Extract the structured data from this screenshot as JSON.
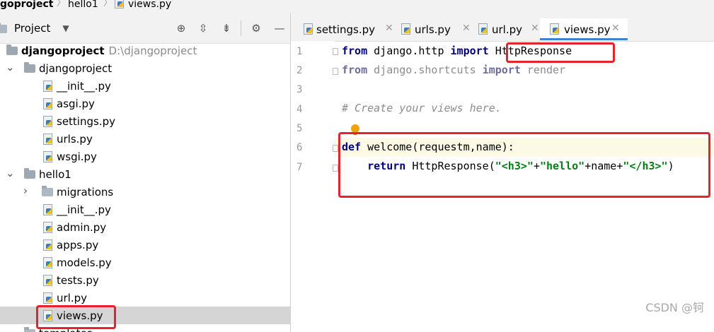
{
  "breadcrumb": {
    "items": [
      "goproject",
      "hello1",
      "views.py"
    ]
  },
  "project_panel": {
    "title": "Project",
    "tool_icons": [
      "locate-icon",
      "expand-all-icon",
      "collapse-all-icon",
      "gear-icon",
      "hide-icon"
    ],
    "tree": [
      {
        "label": "djangoproject",
        "path": "D:\\djangoproject",
        "kind": "root-folder",
        "expanded": true
      },
      {
        "label": "djangoproject",
        "kind": "package",
        "expanded": true
      },
      {
        "label": "__init__.py",
        "kind": "py"
      },
      {
        "label": "asgi.py",
        "kind": "py"
      },
      {
        "label": "settings.py",
        "kind": "py"
      },
      {
        "label": "urls.py",
        "kind": "py"
      },
      {
        "label": "wsgi.py",
        "kind": "py"
      },
      {
        "label": "hello1",
        "kind": "package",
        "expanded": true
      },
      {
        "label": "migrations",
        "kind": "folder",
        "expanded": false
      },
      {
        "label": "__init__.py",
        "kind": "py"
      },
      {
        "label": "admin.py",
        "kind": "py"
      },
      {
        "label": "apps.py",
        "kind": "py"
      },
      {
        "label": "models.py",
        "kind": "py"
      },
      {
        "label": "tests.py",
        "kind": "py"
      },
      {
        "label": "url.py",
        "kind": "py"
      },
      {
        "label": "views.py",
        "kind": "py",
        "selected": true
      },
      {
        "label": "templates",
        "kind": "folder"
      }
    ]
  },
  "editor": {
    "tabs": [
      {
        "label": "settings.py",
        "active": false
      },
      {
        "label": "urls.py",
        "active": false
      },
      {
        "label": "url.py",
        "active": false
      },
      {
        "label": "views.py",
        "active": true
      }
    ],
    "line_numbers": [
      "1",
      "2",
      "3",
      "4",
      "5",
      "6",
      "7"
    ],
    "code": {
      "l1_kw1": "from",
      "l1_mod": " django.http ",
      "l1_kw2": "import",
      "l1_name": "HttpResponse",
      "l2_kw1": "from",
      "l2_mod": " django.shortcuts ",
      "l2_kw2": "import",
      "l2_name": " render",
      "l4_comment": "# Create your views here.",
      "l6_kw": "def",
      "l6_sig": " welcome(requestm,name):",
      "l7_kw": "return",
      "l7_call": " HttpResponse(",
      "l7_s1": "\"<h3>\"",
      "l7_p1": "+",
      "l7_s2": "\"hello\"",
      "l7_p2": "+name+",
      "l7_s3": "\"</h3>\"",
      "l7_end": ")"
    }
  },
  "colors": {
    "annotation_red": "#e8212b",
    "keyword": "#000080",
    "string": "#067d17",
    "comment": "#8c8c8c",
    "tab_active_underline": "#4083c9"
  },
  "watermark": "CSDN @钶"
}
